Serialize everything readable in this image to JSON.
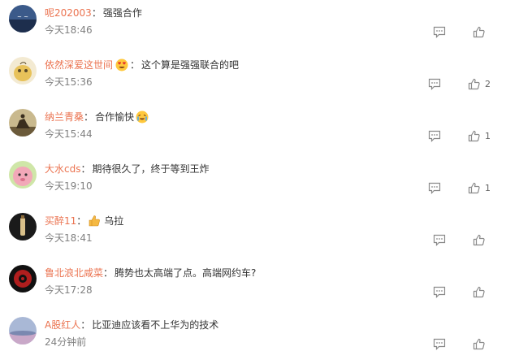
{
  "comments": [
    {
      "username": "呢202003",
      "has_emoji": false,
      "emoji": "",
      "text": "强强合作",
      "time": "今天18:46",
      "likes": ""
    },
    {
      "username": "依然深爱这世间",
      "has_emoji": true,
      "emoji": "heart-eyes-emoji",
      "text": "这个算是强强联合的吧",
      "time": "今天15:36",
      "likes": "2"
    },
    {
      "username": "纳兰青桑",
      "has_emoji": false,
      "emoji": "",
      "text": "合作愉快",
      "text_emoji": "crying-happy-emoji",
      "time": "今天15:44",
      "likes": "1"
    },
    {
      "username": "大水cds",
      "has_emoji": false,
      "emoji": "",
      "text": "期待很久了，终于等到王炸",
      "time": "今天19:10",
      "likes": "1"
    },
    {
      "username": "买醉11",
      "has_emoji": true,
      "emoji": "thumbs-up-emoji",
      "text": "乌拉",
      "time": "今天18:41",
      "likes": ""
    },
    {
      "username": "鲁北浪北咸菜",
      "has_emoji": false,
      "emoji": "",
      "text": "腾势也太高端了点。高端网约车?",
      "time": "今天17:28",
      "likes": ""
    },
    {
      "username": "A股红人",
      "has_emoji": false,
      "emoji": "",
      "text": "比亚迪应该看不上华为的技术",
      "time": "24分钟前",
      "likes": ""
    }
  ],
  "colors": {
    "username": "#eb7350",
    "text": "#333333",
    "time": "#808080",
    "icon": "#8a8a8a"
  }
}
